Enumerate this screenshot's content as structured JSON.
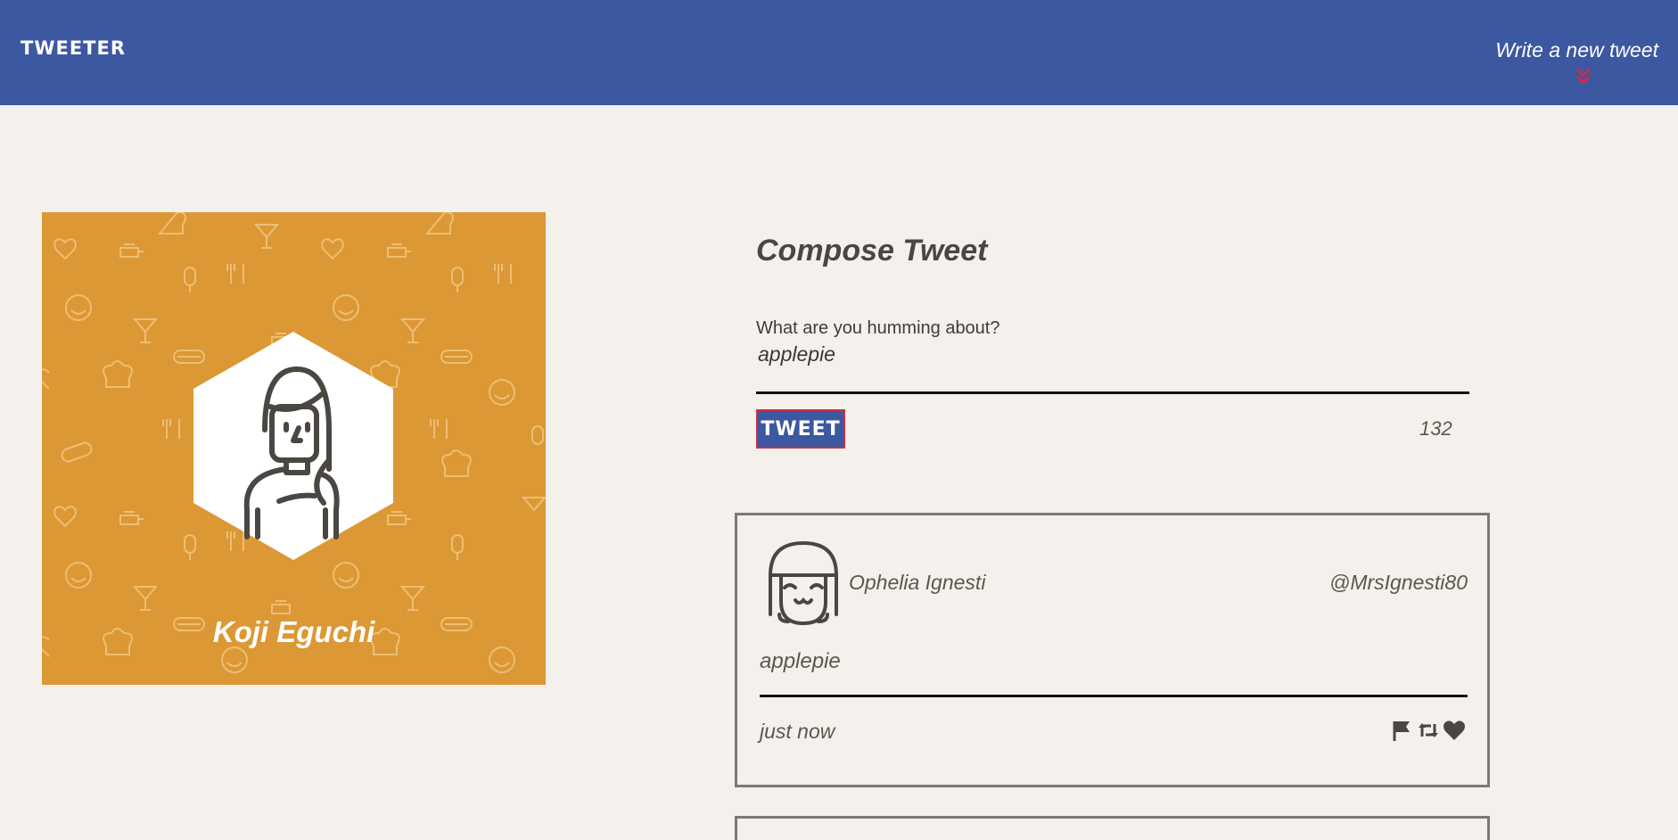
{
  "nav": {
    "brand": "TWEETER",
    "write_link": "Write a new tweet",
    "bg_color": "#3c58a0",
    "chevron_color": "#d12b3e"
  },
  "profile": {
    "name": "Koji Eguchi",
    "bg_color": "#dc9835"
  },
  "compose": {
    "title": "Compose Tweet",
    "label": "What are you humming about?",
    "value": "applepie",
    "button_label": "TWEET",
    "counter": "132"
  },
  "tweets": [
    {
      "name": "Ophelia Ignesti",
      "handle": "@MrsIgnesti80",
      "body": "applepie",
      "time": "just now",
      "actions": [
        "flag-icon",
        "retweet-icon",
        "heart-icon"
      ]
    }
  ]
}
